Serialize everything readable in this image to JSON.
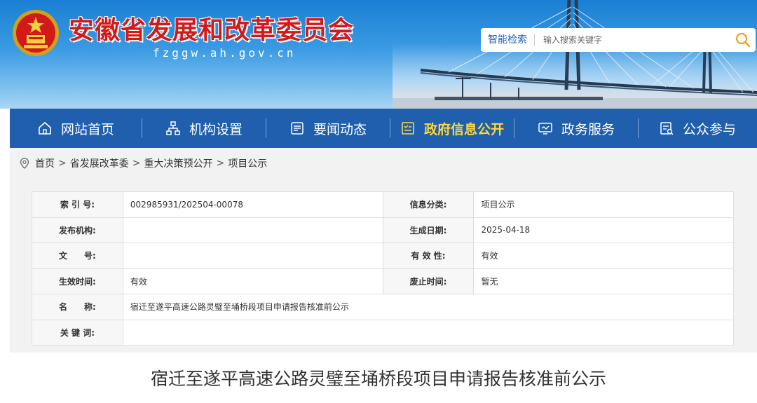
{
  "header": {
    "site_title": "安徽省发展和改革委员会",
    "site_domain": "fzggw.ah.gov.cn",
    "emblem": "national-emblem",
    "search": {
      "label": "智能检索",
      "placeholder": "输入搜索关键字",
      "button_icon": "search-icon"
    }
  },
  "nav": {
    "items": [
      {
        "label": "网站首页",
        "icon": "home-icon",
        "active": false
      },
      {
        "label": "机构设置",
        "icon": "org-chart-icon",
        "active": false
      },
      {
        "label": "要闻动态",
        "icon": "newspaper-icon",
        "active": false
      },
      {
        "label": "政府信息公开",
        "icon": "document-list-icon",
        "active": true
      },
      {
        "label": "政务服务",
        "icon": "monitor-icon",
        "active": false
      },
      {
        "label": "公众参与",
        "icon": "feedback-icon",
        "active": false
      }
    ],
    "active_color": "#ffd83a"
  },
  "breadcrumb": {
    "icon": "location-pin-icon",
    "items": [
      "首页",
      "省发展改革委",
      "重大决策预公开",
      "项目公示"
    ],
    "separator": ">"
  },
  "info_table": {
    "rows": [
      {
        "l1": "索 引 号:",
        "v1": "002985931/202504-00078",
        "l2": "信息分类:",
        "v2": "项目公示"
      },
      {
        "l1": "发布机构:",
        "v1": "",
        "l2": "生成日期:",
        "v2": "2025-04-18"
      },
      {
        "l1": "文　　号:",
        "v1": "",
        "l2": "有 效 性:",
        "v2": "有效"
      },
      {
        "l1": "生效时间:",
        "v1": "有效",
        "l2": "废止时间:",
        "v2": "暂无"
      }
    ],
    "name_row": {
      "label": "名　　称:",
      "value": "宿迁至遂平高速公路灵璧至埇桥段项目申请报告核准前公示"
    },
    "keywords_row": {
      "label": "关 键 词:",
      "value": ""
    }
  },
  "article": {
    "title": "宿迁至遂平高速公路灵璧至埇桥段项目申请报告核准前公示"
  },
  "colors": {
    "brand_red": "#d31a1a",
    "nav_blue": "#1f5fae",
    "header_blue": "#1a7fd3"
  }
}
